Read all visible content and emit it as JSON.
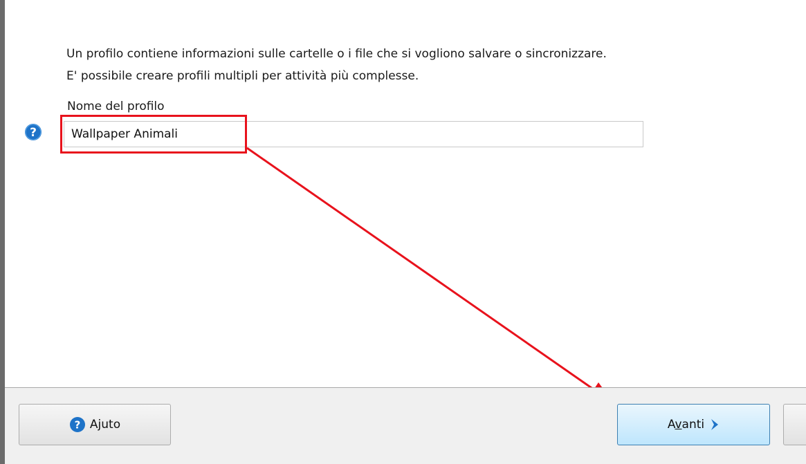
{
  "description": {
    "line1": "Un profilo contiene informazioni sulle cartelle o i file che si vogliono salvare o sincronizzare.",
    "line2": "E' possibile creare profili multipli per attività più complesse."
  },
  "profile": {
    "label": "Nome del profilo",
    "value": "Wallpaper Animali"
  },
  "buttons": {
    "help_pre": "A",
    "help_mnemonic": "j",
    "help_post": "uto",
    "next_pre": "A",
    "next_mnemonic": "v",
    "next_post": "anti"
  },
  "icons": {
    "help": "question-circle-icon",
    "next": "chevron-right-icon"
  },
  "colors": {
    "annotation": "#e8121c",
    "help_icon": "#1e73c8",
    "next_border": "#3c7fb1"
  }
}
